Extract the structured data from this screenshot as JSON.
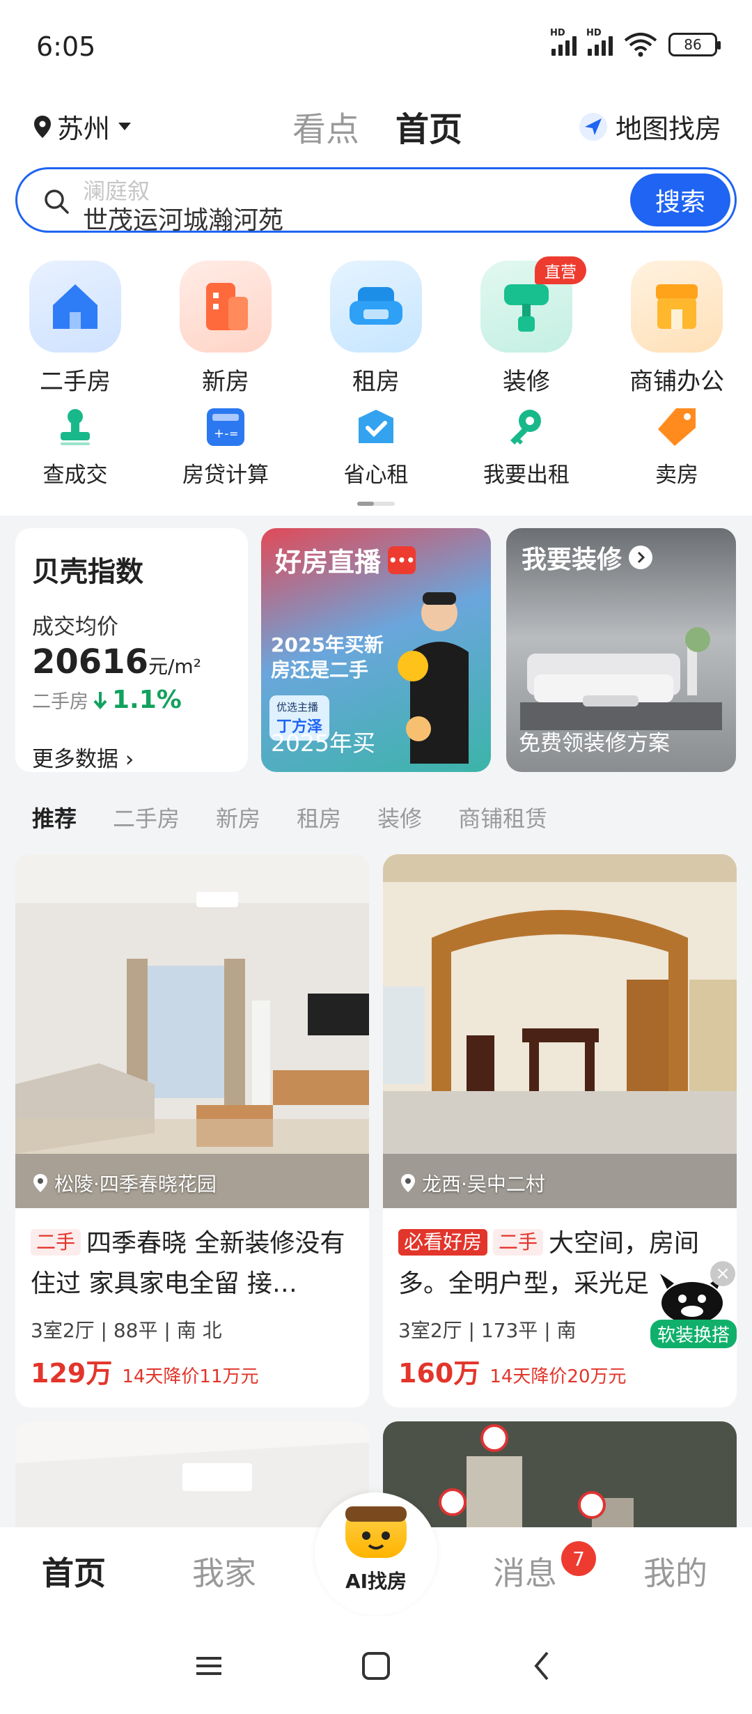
{
  "status": {
    "time": "6:05",
    "battery": "86",
    "hd": "HD"
  },
  "header": {
    "city": "苏州",
    "tabs": [
      {
        "label": "看点",
        "active": false
      },
      {
        "label": "首页",
        "active": true
      }
    ],
    "map_label": "地图找房"
  },
  "search": {
    "hint": "澜庭叙",
    "value": "世茂运河城瀚河苑",
    "button": "搜索"
  },
  "quick_main": [
    {
      "label": "二手房",
      "icon": "house-icon"
    },
    {
      "label": "新房",
      "icon": "building-icon"
    },
    {
      "label": "租房",
      "icon": "sofa-icon"
    },
    {
      "label": "装修",
      "icon": "paint-roller-icon",
      "badge": "直营"
    },
    {
      "label": "商铺办公",
      "icon": "shop-icon"
    }
  ],
  "quick_sub": [
    {
      "label": "查成交",
      "icon": "stamp-icon"
    },
    {
      "label": "房贷计算",
      "icon": "calculator-icon"
    },
    {
      "label": "省心租",
      "icon": "check-box-icon"
    },
    {
      "label": "我要出租",
      "icon": "key-icon"
    },
    {
      "label": "卖房",
      "icon": "tag-icon"
    }
  ],
  "index_card": {
    "title": "贝壳指数",
    "sub": "成交均价",
    "price": "20616",
    "unit": "元/m²",
    "type": "二手房",
    "change": "1.1%",
    "more": "更多数据"
  },
  "live_card": {
    "title": "好房直播",
    "headline": "2025年买新\n房还是二手",
    "host_tag": "优选主播",
    "host": "丁方泽",
    "bottom": "2025年买"
  },
  "deco_card": {
    "title": "我要装修",
    "bottom": "免费领装修方案"
  },
  "filters": [
    {
      "label": "推荐",
      "active": true
    },
    {
      "label": "二手房",
      "active": false
    },
    {
      "label": "新房",
      "active": false
    },
    {
      "label": "租房",
      "active": false
    },
    {
      "label": "装修",
      "active": false
    },
    {
      "label": "商铺租赁",
      "active": false
    }
  ],
  "listings": [
    {
      "location": "松陵·四季春晓花园",
      "tags": [
        "二手"
      ],
      "title": "四季春晓 全新装修没有住过 家具家电全留 接…",
      "meta": "3室2厅 | 88平 | 南 北",
      "price": "129万",
      "drop": "14天降价11万元"
    },
    {
      "location": "龙西·吴中二村",
      "tags": [
        "必看好房",
        "二手"
      ],
      "title": "大空间，房间多。全明户型，采光足",
      "meta": "3室2厅 | 173平 | 南",
      "price": "160万",
      "drop": "14天降价20万元"
    }
  ],
  "sticker": {
    "label": "软装换搭"
  },
  "tabbar": {
    "items": [
      "首页",
      "我家",
      "消息",
      "我的"
    ],
    "ai_label": "AI找房",
    "message_badge": "7"
  },
  "colors": {
    "accent": "#1f64f2",
    "price_red": "#e2352b",
    "green": "#13a15e"
  }
}
